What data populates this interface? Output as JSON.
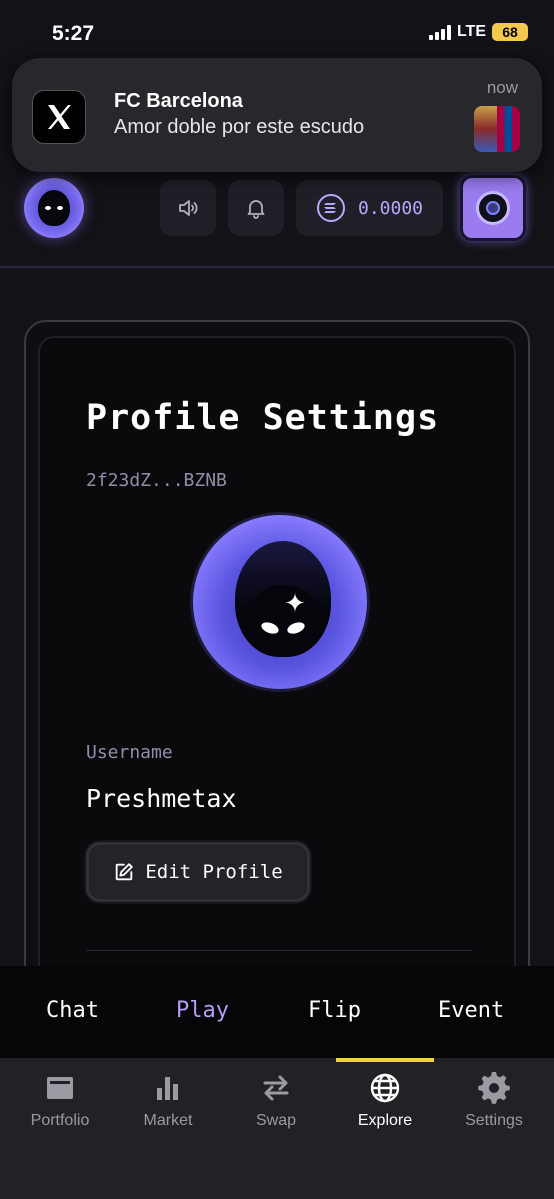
{
  "status": {
    "time": "5:27",
    "network": "LTE",
    "battery": "68"
  },
  "notification": {
    "app_icon": "x-logo-icon",
    "title": "FC Barcelona",
    "body": "Amor doble por este escudo",
    "time": "now"
  },
  "header": {
    "balance": "0.0000"
  },
  "profile": {
    "title": "Profile Settings",
    "wallet": "2f23dZ...BZNB",
    "username_label": "Username",
    "username": "Preshmetax",
    "edit_label": "Edit Profile"
  },
  "game_tabs": [
    {
      "label": "Chat"
    },
    {
      "label": "Play",
      "active": true
    },
    {
      "label": "Flip"
    },
    {
      "label": "Event"
    }
  ],
  "bottom_nav": [
    {
      "label": "Portfolio",
      "icon": "wallet-icon"
    },
    {
      "label": "Market",
      "icon": "bar-chart-icon"
    },
    {
      "label": "Swap",
      "icon": "swap-icon"
    },
    {
      "label": "Explore",
      "icon": "globe-icon",
      "active": true
    },
    {
      "label": "Settings",
      "icon": "gear-icon"
    }
  ],
  "colors": {
    "accent": "#b79cf5",
    "indicator": "#f2d43c",
    "battery": "#f2c94c"
  }
}
